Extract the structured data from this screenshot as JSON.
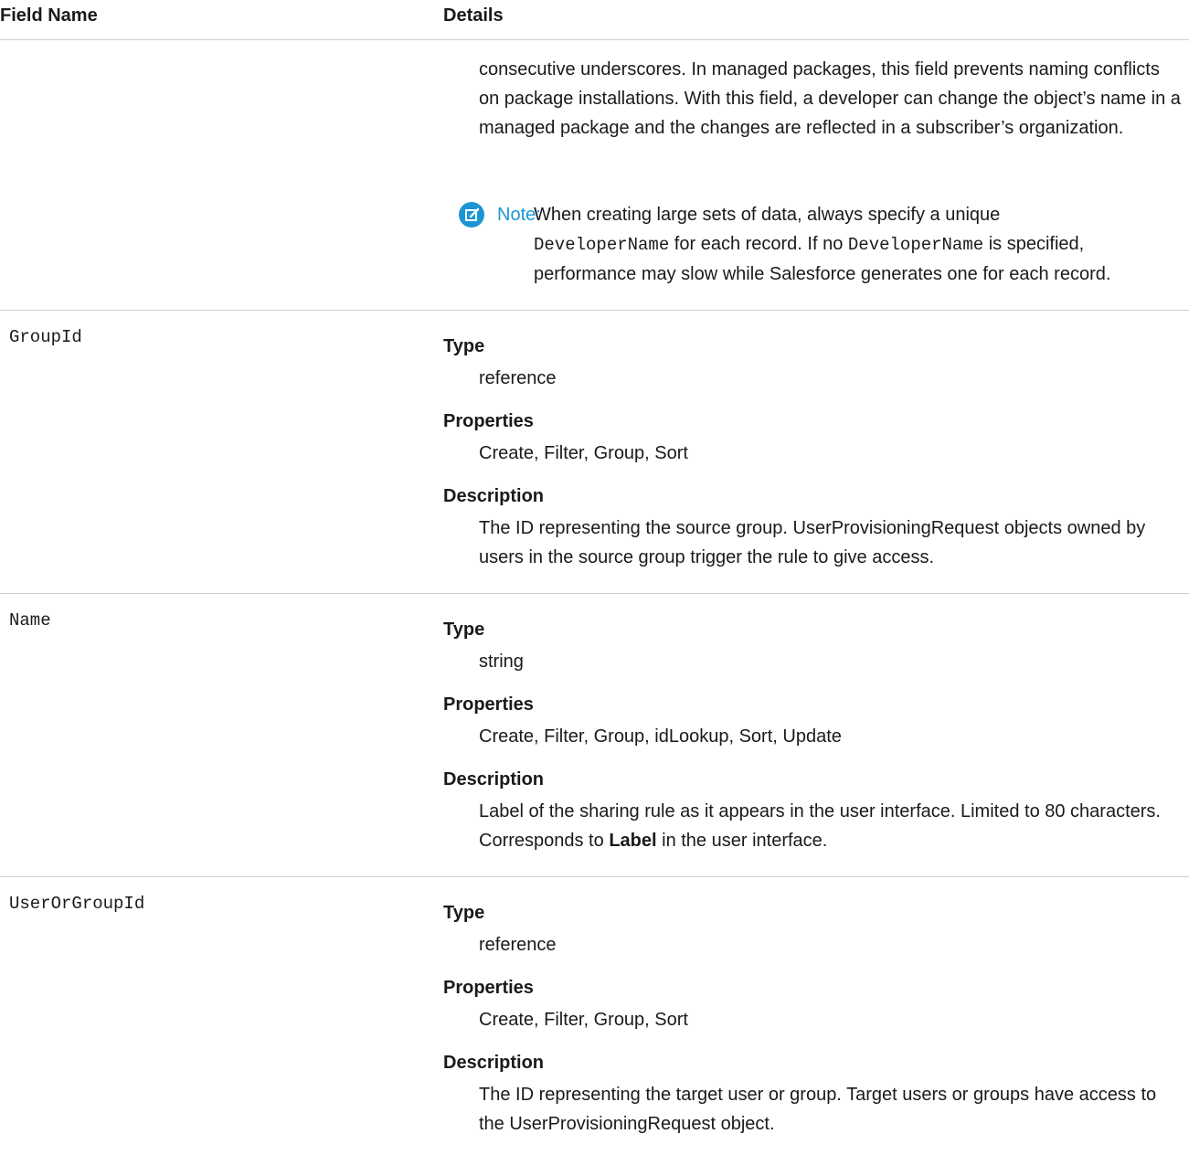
{
  "header": {
    "col1": "Field Name",
    "col2": "Details"
  },
  "continuation": {
    "text": "consecutive underscores. In managed packages, this field prevents naming conflicts on package installations. With this field, a developer can change the object’s name in a managed package and the changes are reflected in a subscriber’s organization."
  },
  "note": {
    "label": "Note:",
    "part1": "When creating large sets of data, always specify a unique",
    "code1": "DeveloperName",
    "part2": "for each record. If no",
    "code2": "DeveloperName",
    "part3": "is specified, performance may slow while Salesforce generates one for each record.",
    "icon": "edit-note-icon"
  },
  "labels": {
    "type": "Type",
    "properties": "Properties",
    "description": "Description"
  },
  "fields": [
    {
      "name": "GroupId",
      "type": "reference",
      "properties": "Create, Filter, Group, Sort",
      "description": "The ID representing the source group. UserProvisioningRequest objects owned by users in the source group trigger the rule to give access."
    },
    {
      "name": "Name",
      "type": "string",
      "properties": "Create, Filter, Group, idLookup, Sort, Update",
      "description_pre": "Label of the sharing rule as it appears in the user interface. Limited to 80 characters. Corresponds to",
      "description_bold": "Label",
      "description_post": "in the user interface."
    },
    {
      "name": "UserOrGroupId",
      "type": "reference",
      "properties": "Create, Filter, Group, Sort",
      "description": "The ID representing the target user or group. Target users or groups have access to the UserProvisioningRequest object."
    }
  ]
}
